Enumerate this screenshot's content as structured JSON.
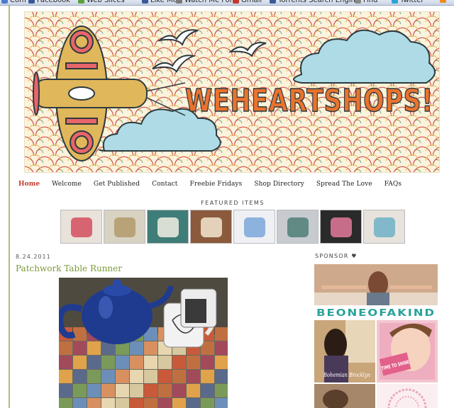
{
  "bookmarks": [
    {
      "label": "Com",
      "icon": "globe-icon",
      "color": "#4a7bd1"
    },
    {
      "label": "Facebook",
      "icon": "facebook-icon",
      "color": "#3b5998"
    },
    {
      "label": "Web Slices",
      "icon": "webslice-icon",
      "color": "#5aa33c"
    },
    {
      "label": "Like Me",
      "icon": "page-icon",
      "color": "#3b5998"
    },
    {
      "label": "Watch Me Form",
      "icon": "page-icon",
      "color": "#7a7a7a"
    },
    {
      "label": "Gmail",
      "icon": "mail-icon",
      "color": "#c0392b"
    },
    {
      "label": "Torrents Search Engine",
      "icon": "search-icon",
      "color": "#3b5998"
    },
    {
      "label": "Find",
      "icon": "globe-icon",
      "color": "#888888"
    },
    {
      "label": "Twitter",
      "icon": "bird-icon",
      "color": "#2aa3d9"
    },
    {
      "label": "",
      "icon": "rss-icon",
      "color": "#f08a24"
    }
  ],
  "banner": {
    "title": "WEHEARTSHOPS!",
    "colors": {
      "letters": "#e9732e",
      "clouds": "#aedbe6",
      "plane": "#e0b75a",
      "dots": "#e8656a"
    }
  },
  "nav": [
    {
      "label": "Home",
      "active": true
    },
    {
      "label": "Welcome",
      "active": false
    },
    {
      "label": "Get Published",
      "active": false
    },
    {
      "label": "Contact",
      "active": false
    },
    {
      "label": "Freebie Fridays",
      "active": false
    },
    {
      "label": "Shop Directory",
      "active": false
    },
    {
      "label": "Spread The Love",
      "active": false
    },
    {
      "label": "FAQs",
      "active": false
    }
  ],
  "featured": {
    "title": "FEATURED ITEMS",
    "thumbs": [
      {
        "name": "fabric-pouch",
        "bg": "#e9e2da",
        "accent": "#d34f5e"
      },
      {
        "name": "gift-tags",
        "bg": "#d8d2c2",
        "accent": "#b39a6a"
      },
      {
        "name": "teal-card",
        "bg": "#3f7d78",
        "accent": "#f3efe4"
      },
      {
        "name": "jar-label",
        "bg": "#8b5a3c",
        "accent": "#f2e6d0"
      },
      {
        "name": "cloud-tee",
        "bg": "#eef0f4",
        "accent": "#7aa7d8"
      },
      {
        "name": "bangles",
        "bg": "#c7cbcf",
        "accent": "#4f7f78"
      },
      {
        "name": "heart-frames",
        "bg": "#2a2a2a",
        "accent": "#e27a9a"
      },
      {
        "name": "rosette-pin",
        "bg": "#e7e3dc",
        "accent": "#6fb2c7"
      }
    ]
  },
  "post": {
    "date": "8.24.2011",
    "title": "Patchwork Table Runner"
  },
  "sidebar": {
    "sponsor_title": "SPONSOR ♥",
    "ads": [
      {
        "label": "BEONEOFAKIND"
      },
      {
        "label": "Bohemian Brocklyn"
      },
      {
        "label": "TIME TO SHINE"
      }
    ]
  }
}
